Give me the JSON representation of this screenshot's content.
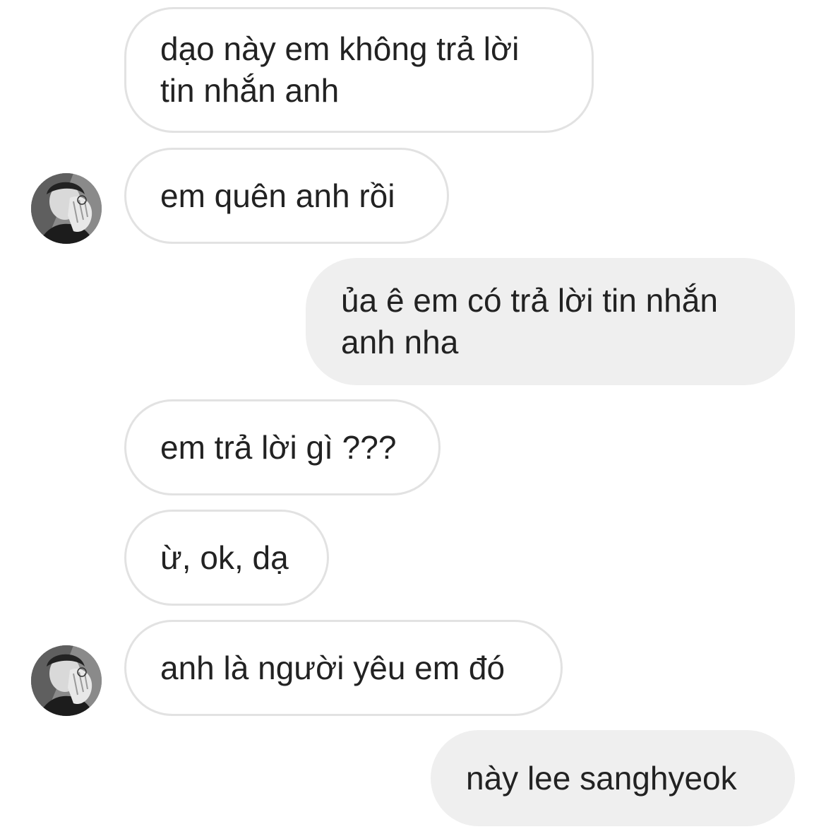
{
  "thread": {
    "messages": [
      {
        "sender": "them",
        "lines": [
          "dạo này em không trả lời",
          "tin nhắn anh"
        ]
      },
      {
        "sender": "them",
        "text": "em quên anh rồi",
        "avatar": "contact-avatar"
      },
      {
        "sender": "me",
        "lines": [
          "ủa ê em có trả lời tin nhắn",
          "anh nha"
        ]
      },
      {
        "sender": "them",
        "text": "em trả lời gì ???"
      },
      {
        "sender": "them",
        "text": "ừ, ok, dạ"
      },
      {
        "sender": "them",
        "text": "anh là người yêu em đó",
        "avatar": "contact-avatar"
      },
      {
        "sender": "me",
        "text": "này lee sanghyeok"
      }
    ]
  },
  "colors": {
    "incoming_bg": "#ffffff",
    "incoming_border": "#e2e2e2",
    "outgoing_bg": "#efefef",
    "text": "#222222"
  }
}
